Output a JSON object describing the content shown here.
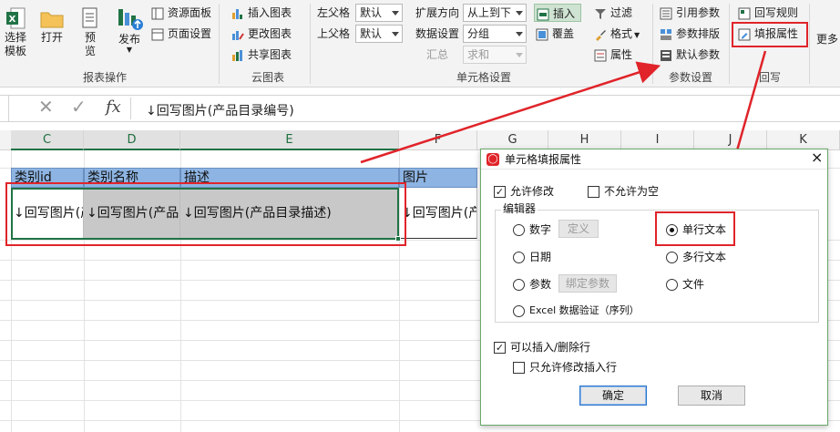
{
  "ribbon": {
    "report_ops": {
      "select_template": "选择\n模板",
      "open": "打开",
      "preview": "预\n览",
      "publish": "发布",
      "resource_panel": "资源面板",
      "page_setup": "页面设置",
      "group_label": "报表操作"
    },
    "cloud_chart": {
      "insert_chart": "插入图表",
      "edit_chart": "更改图表",
      "share_chart": "共享图表",
      "group_label": "云图表"
    },
    "cell_settings": {
      "left_parent_label": "左父格",
      "left_parent_value": "默认",
      "top_parent_label": "上父格",
      "top_parent_value": "默认",
      "expand_dir_label": "扩展方向",
      "expand_dir_value": "从上到下",
      "data_setting_label": "数据设置",
      "data_setting_value": "分组",
      "summary_label": "汇总",
      "summary_value": "求和",
      "insert": "插入",
      "cover": "覆盖",
      "filter": "过滤",
      "format": "格式",
      "property": "属性",
      "group_label": "单元格设置"
    },
    "param_settings": {
      "ref_param": "引用参数",
      "param_layout": "参数排版",
      "default_param": "默认参数",
      "group_label": "参数设置"
    },
    "writeback": {
      "writeback_rule": "回写规则",
      "fill_property": "填报属性",
      "group_label": "回写"
    },
    "more": "更多"
  },
  "formula_bar": {
    "content": "↓回写图片(产品目录编号)"
  },
  "sheet": {
    "columns": [
      "C",
      "D",
      "E",
      "F",
      "G",
      "H",
      "I",
      "J",
      "K"
    ],
    "headers": [
      "类别id",
      "类别名称",
      "描述",
      "图片"
    ],
    "cells": [
      "↓回写图片(产",
      "↓回写图片(产品",
      "↓回写图片(产品目录描述)",
      "↓回写图片(产"
    ]
  },
  "dialog": {
    "title": "单元格填报属性",
    "close": "×",
    "allow_modify": "允许修改",
    "not_allow_empty": "不允许为空",
    "editor_group": "编辑器",
    "number": "数字",
    "define_btn": "定义",
    "single_text": "单行文本",
    "date": "日期",
    "multi_text": "多行文本",
    "param": "参数",
    "bind_param_btn": "绑定参数",
    "file": "文件",
    "excel_validation": "Excel 数据验证（序列）",
    "allow_insert_delete": "可以插入/删除行",
    "only_modify_inserted": "只允许修改插入行",
    "ok": "确定",
    "cancel": "取消"
  },
  "colors": {
    "highlight": "#e0242a",
    "header_fill": "#8db4e2",
    "selected_fill": "#c8c8c8",
    "accent_green": "#217346"
  }
}
